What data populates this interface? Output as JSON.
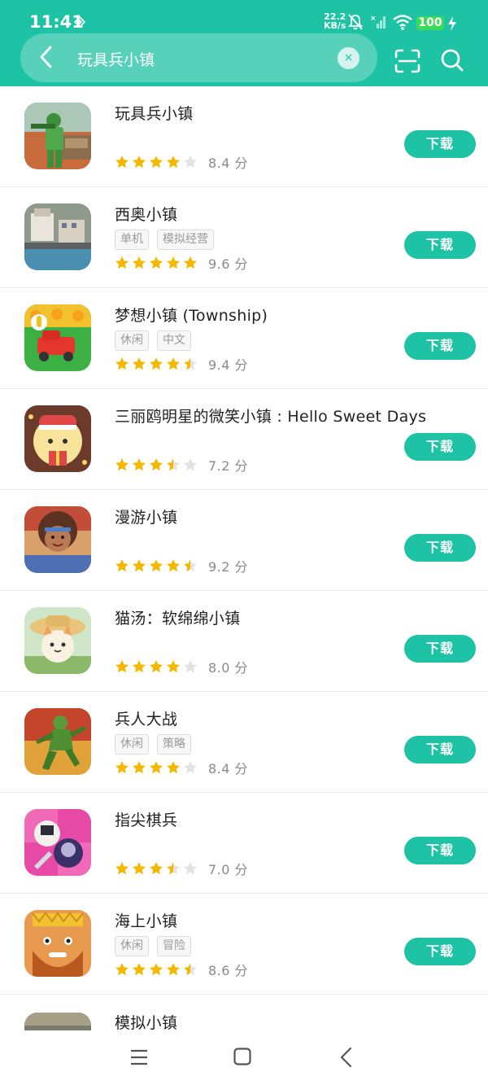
{
  "status_bar": {
    "time": "11:41",
    "net_rate": "22.2",
    "net_unit": "KB/s",
    "battery": "100"
  },
  "search": {
    "query": "玩具兵小镇",
    "clear_symbol": "×"
  },
  "download_label": "下载",
  "score_unit": "分",
  "apps": [
    {
      "name": "玩具兵小镇",
      "tags": [],
      "rating": 4,
      "score": "8.4",
      "icon": "toy-soldier-town-icon"
    },
    {
      "name": "西奥小镇",
      "tags": [
        "单机",
        "模拟经营"
      ],
      "rating": 5,
      "score": "9.6",
      "icon": "theotown-icon"
    },
    {
      "name": "梦想小镇 (Township)",
      "tags": [
        "休闲",
        "中文"
      ],
      "rating": 4.5,
      "score": "9.4",
      "icon": "township-icon"
    },
    {
      "name": "三丽鸥明星的微笑小镇 : Hello Sweet Days",
      "tags": [],
      "rating": 3.5,
      "score": "7.2",
      "icon": "hello-sweet-days-icon"
    },
    {
      "name": "漫游小镇",
      "tags": [],
      "rating": 4.5,
      "score": "9.2",
      "icon": "wandering-town-icon"
    },
    {
      "name": "猫汤：软绵绵小镇",
      "tags": [],
      "rating": 4,
      "score": "8.0",
      "icon": "cat-soup-town-icon"
    },
    {
      "name": "兵人大战",
      "tags": [
        "休闲",
        "策略"
      ],
      "rating": 4,
      "score": "8.4",
      "icon": "army-men-battle-icon"
    },
    {
      "name": "指尖棋兵",
      "tags": [],
      "rating": 3.5,
      "score": "7.0",
      "icon": "fingertip-chess-icon"
    },
    {
      "name": "海上小镇",
      "tags": [
        "休闲",
        "冒险"
      ],
      "rating": 4.5,
      "score": "8.6",
      "icon": "sea-town-icon"
    }
  ],
  "partial_app": {
    "name": "模拟小镇"
  },
  "colors": {
    "accent": "#1ec2a4",
    "star_on": "#f5b700",
    "star_off": "#e3e3e3",
    "battery": "#3adb55"
  }
}
